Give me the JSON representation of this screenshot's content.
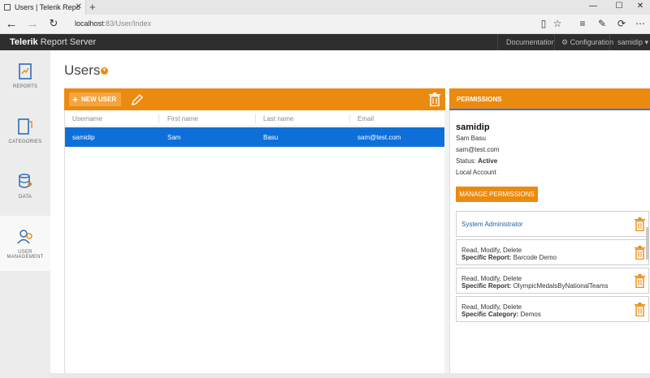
{
  "browser": {
    "tab_title": "Users | Telerik Report Se",
    "url_host": "localhost",
    "url_rest": ":83/User/Index"
  },
  "header": {
    "brand_main": "Telerik",
    "brand_sub": " Report Server",
    "documentation": "Documentation",
    "configuration": "Configuration",
    "user_menu": "samidip ▾"
  },
  "sidebar": {
    "items": [
      {
        "label": "REPORTS"
      },
      {
        "label": "CATEGORIES"
      },
      {
        "label": "DATA"
      },
      {
        "label": "USER MANAGEMENT"
      }
    ]
  },
  "main": {
    "title": "Users",
    "new_user_label": "NEW USER",
    "columns": [
      "Username",
      "First name",
      "Last name",
      "Email"
    ],
    "rows": [
      {
        "username": "samidip",
        "first": "Sam",
        "last": "Basu",
        "email": "sam@test.com"
      }
    ]
  },
  "permissions": {
    "title": "PERMISSIONS",
    "username": "samidip",
    "full_name": "Sam Basu",
    "email": "sam@test.com",
    "status_label": "Status: ",
    "status_value": "Active",
    "account_type": "Local Account",
    "manage_label": "MANAGE PERMISSIONS",
    "cards": [
      {
        "line1": "System Administrator",
        "label": "",
        "value": ""
      },
      {
        "line1": "Read, Modify, Delete",
        "label": "Specific Report:",
        "value": " Barcode Demo"
      },
      {
        "line1": "Read, Modify, Delete",
        "label": "Specific Report:",
        "value": " OlympicMedalsByNationalTeams"
      },
      {
        "line1": "Read, Modify, Delete",
        "label": "Specific Category:",
        "value": " Demos"
      }
    ]
  },
  "colors": {
    "accent": "#ec8a0f",
    "selection": "#0e6fd8",
    "header_bg": "#2e2e2e"
  }
}
